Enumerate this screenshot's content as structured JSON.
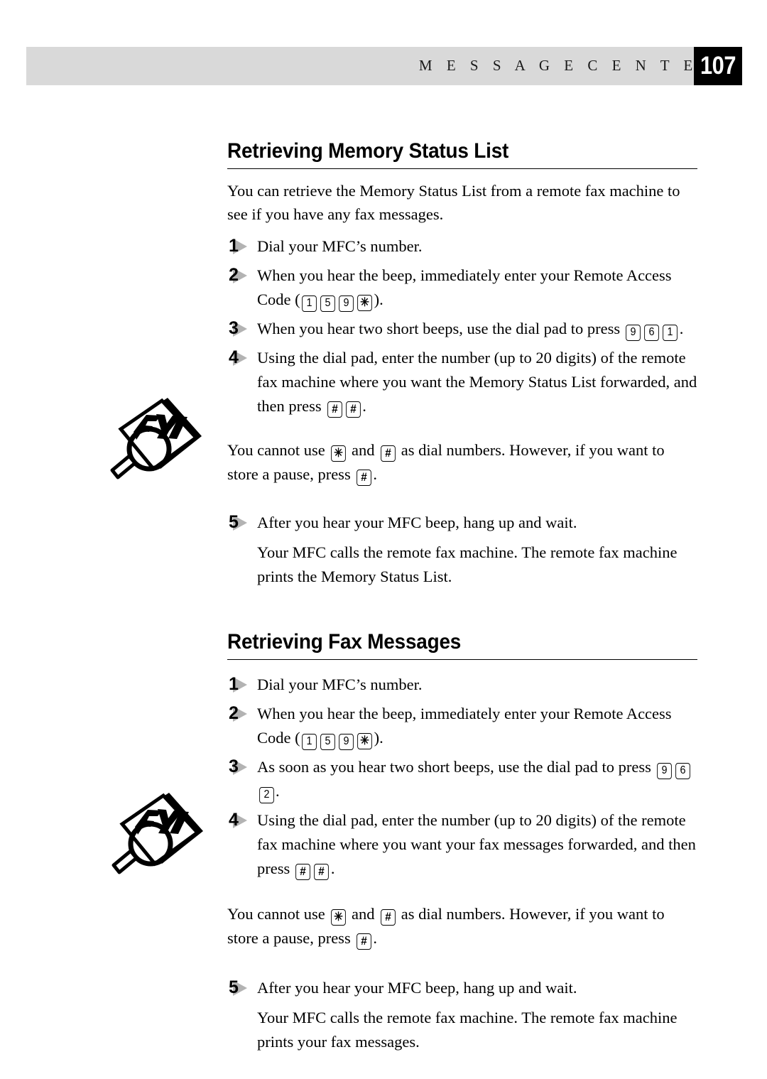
{
  "header": {
    "running_title": "M E S S A G E   C E N T E R",
    "page_number": "107"
  },
  "sections": [
    {
      "heading": "Retrieving Memory Status List",
      "intro": "You can retrieve the Memory Status List from a remote fax machine to see if you have any fax messages.",
      "steps": [
        {
          "number": "1",
          "text_1": "Dial your MFC’s number."
        },
        {
          "number": "2",
          "text_1": "When you hear the beep, immediately enter your Remote Access Code (",
          "keys": [
            "1",
            "5",
            "9",
            "✳"
          ],
          "text_2": ")."
        },
        {
          "number": "3",
          "text_1": "When you hear two short beeps, use the dial pad to press ",
          "keys": [
            "9",
            "6",
            "1"
          ],
          "text_2": "."
        },
        {
          "number": "4",
          "text_1": "Using the dial pad, enter the number (up to 20 digits) of the remote fax machine where you want the Memory Status List forwarded, and then press ",
          "keys": [
            "#",
            "#"
          ],
          "text_2": "."
        },
        {
          "number": "5",
          "text_1": "After you hear your MFC beep, hang up and wait."
        }
      ],
      "note": {
        "icon": "fyi-icon",
        "text_1": "You cannot use ",
        "key_1": "✳",
        "text_2": " and ",
        "key_2": "#",
        "text_3": " as dial numbers.  However, if you want to store a pause, press ",
        "key_3": "#",
        "text_4": "."
      },
      "closing": "Your MFC calls the remote fax machine.  The remote fax machine prints the Memory Status List."
    },
    {
      "heading": "Retrieving Fax Messages",
      "steps": [
        {
          "number": "1",
          "text_1": "Dial your MFC’s number."
        },
        {
          "number": "2",
          "text_1": "When you hear the beep, immediately enter your Remote Access Code (",
          "keys": [
            "1",
            "5",
            "9",
            "✳"
          ],
          "text_2": ")."
        },
        {
          "number": "3",
          "text_1": "As soon as you hear two short beeps, use the dial pad to press ",
          "keys": [
            "9",
            "6",
            "2"
          ],
          "text_2": "."
        },
        {
          "number": "4",
          "text_1": "Using the dial pad, enter the number (up to 20 digits) of the remote fax machine where you want your fax messages forwarded, and then press ",
          "keys": [
            "#",
            "#"
          ],
          "text_2": "."
        },
        {
          "number": "5",
          "text_1": "After you hear your MFC beep, hang up and wait."
        }
      ],
      "note": {
        "icon": "fyi-icon",
        "text_1": "You cannot use ",
        "key_1": "✳",
        "text_2": " and ",
        "key_2": "#",
        "text_3": " as dial numbers.  However, if you want to store a pause, press ",
        "key_3": "#",
        "text_4": "."
      },
      "closing": "Your MFC calls the remote fax machine.  The remote fax machine prints your fax messages."
    }
  ],
  "icons": {
    "fyi_label": "FYI"
  }
}
